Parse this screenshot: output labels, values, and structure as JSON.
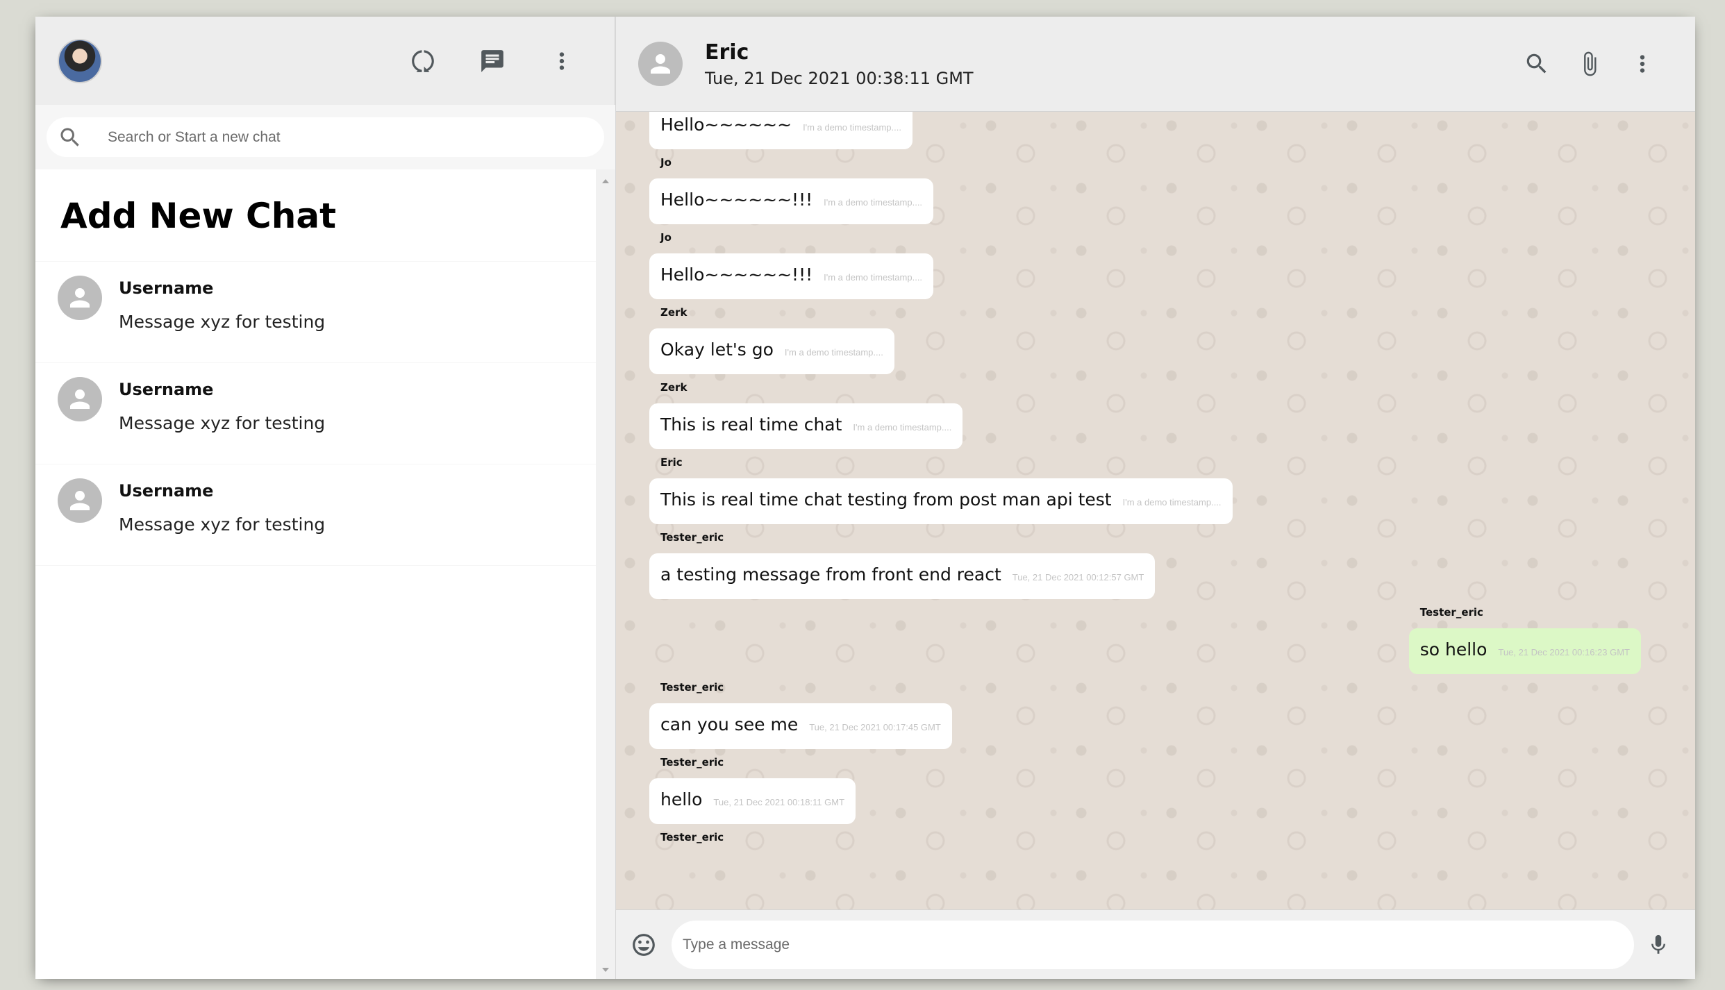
{
  "sidebar": {
    "icons": {
      "status": "status-icon",
      "new_chat": "chat-icon",
      "menu": "more-vert-icon"
    },
    "search": {
      "placeholder": "Search or Start a new chat"
    },
    "add_new_chat": "Add New Chat",
    "chats": [
      {
        "name": "Username",
        "last_message": "Message xyz for testing"
      },
      {
        "name": "Username",
        "last_message": "Message xyz for testing"
      },
      {
        "name": "Username",
        "last_message": "Message xyz for testing"
      }
    ]
  },
  "chat": {
    "header": {
      "name": "Eric",
      "last_seen": "Tue, 21 Dec 2021 00:38:11 GMT"
    },
    "messages": [
      {
        "sender": "",
        "text": "Hello~~~~~~",
        "timestamp": "I'm a demo timestamp....",
        "mine": false
      },
      {
        "sender": "Jo",
        "text": "Hello~~~~~~!!!",
        "timestamp": "I'm a demo timestamp....",
        "mine": false
      },
      {
        "sender": "Jo",
        "text": "Hello~~~~~~!!!",
        "timestamp": "I'm a demo timestamp....",
        "mine": false
      },
      {
        "sender": "Zerk",
        "text": "Okay let's go",
        "timestamp": "I'm a demo timestamp....",
        "mine": false
      },
      {
        "sender": "Zerk",
        "text": "This is real time chat",
        "timestamp": "I'm a demo timestamp....",
        "mine": false
      },
      {
        "sender": "Eric",
        "text": "This is real time chat testing from post man api test",
        "timestamp": "I'm a demo timestamp....",
        "mine": false
      },
      {
        "sender": "Tester_eric",
        "text": "a testing message from front end react",
        "timestamp": "Tue, 21 Dec 2021 00:12:57 GMT",
        "mine": false
      },
      {
        "sender": "Tester_eric",
        "text": "so hello",
        "timestamp": "Tue, 21 Dec 2021 00:16:23 GMT",
        "mine": true
      },
      {
        "sender": "Tester_eric",
        "text": "can you see me",
        "timestamp": "Tue, 21 Dec 2021 00:17:45 GMT",
        "mine": false
      },
      {
        "sender": "Tester_eric",
        "text": "hello",
        "timestamp": "Tue, 21 Dec 2021 00:18:11 GMT",
        "mine": false
      },
      {
        "sender": "Tester_eric",
        "text": "",
        "timestamp": "",
        "mine": false
      }
    ],
    "footer": {
      "placeholder": "Type a message"
    }
  },
  "colors": {
    "background": "#dadbd3",
    "header": "#ededed",
    "chat_bg": "#e5ddd5",
    "bubble": "#ffffff",
    "my_bubble": "#dcf8c6"
  }
}
